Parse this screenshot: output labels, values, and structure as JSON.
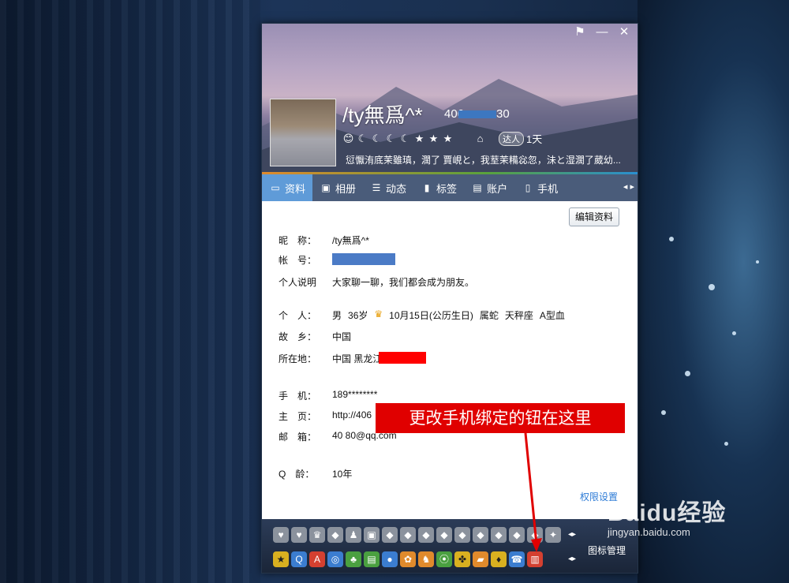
{
  "window": {
    "controls": {
      "pin": "⚑",
      "minimize": "—",
      "close": "✕"
    },
    "profile": {
      "nickname": "/ty無爲^*",
      "qq_prefix": "406",
      "qq_suffix": "30",
      "levels": [
        "😊",
        "☾",
        "☾",
        "☾",
        "☾",
        "★",
        "★",
        "★"
      ],
      "badge": "达人",
      "days": "1天",
      "signature": "愆懨洧底茉雖瑱，濶了 賈峴と，我荎茉糒惢忽，沬と湿濶了葳幼..."
    },
    "tabs": [
      {
        "icon": "▭",
        "label": "资料"
      },
      {
        "icon": "▣",
        "label": "相册"
      },
      {
        "icon": "☰",
        "label": "动态"
      },
      {
        "icon": "▮",
        "label": "标签"
      },
      {
        "icon": "▤",
        "label": "账户"
      },
      {
        "icon": "▯",
        "label": "手机"
      }
    ],
    "tab_scroll": "◂ ▸",
    "edit_button": "编辑资料",
    "info": {
      "nick_label": "昵　称：",
      "nick_value": "/ty無爲^*",
      "account_label": "帐　号：",
      "intro_label": "个人说明",
      "intro_value": "大家聊一聊，我们都会成为朋友。",
      "personal_label": "个　人：",
      "gender": "男",
      "age": "36岁",
      "birthday": "10月15日(公历生日)",
      "zodiac": "属蛇",
      "star": "天秤座",
      "blood": "A型血",
      "hometown_label": "故　乡：",
      "hometown_value": "中国",
      "location_label": "所在地：",
      "location_value": "中国 黑龙江",
      "phone_label": "手　机：",
      "phone_value": "189********",
      "homepage_label": "主　页：",
      "homepage_value": "http://406",
      "email_label": "邮　箱：",
      "email_value": "40        80@qq.com",
      "qage_label": "Q　龄：",
      "qage_value": "10年"
    },
    "permission_link": "权限设置",
    "callout": "更改手机绑定的钮在这里",
    "icon_rows": {
      "row1": [
        "♥",
        "♥",
        "♛",
        "◆",
        "♟",
        "▣",
        "◆",
        "◆",
        "◆",
        "◆",
        "◆",
        "◆",
        "◆",
        "◆",
        "◆",
        "✦",
        "❀"
      ],
      "row2": [
        "★",
        "Q",
        "A",
        "◎",
        "♣",
        "▤",
        "●",
        "✿",
        "♞",
        "⦿",
        "✤",
        "▰",
        "♦",
        "☎",
        "▥"
      ]
    },
    "icon_manager": "图标管理"
  },
  "watermark": {
    "brand": "Baidu经验",
    "url": "jingyan.baidu.com"
  }
}
